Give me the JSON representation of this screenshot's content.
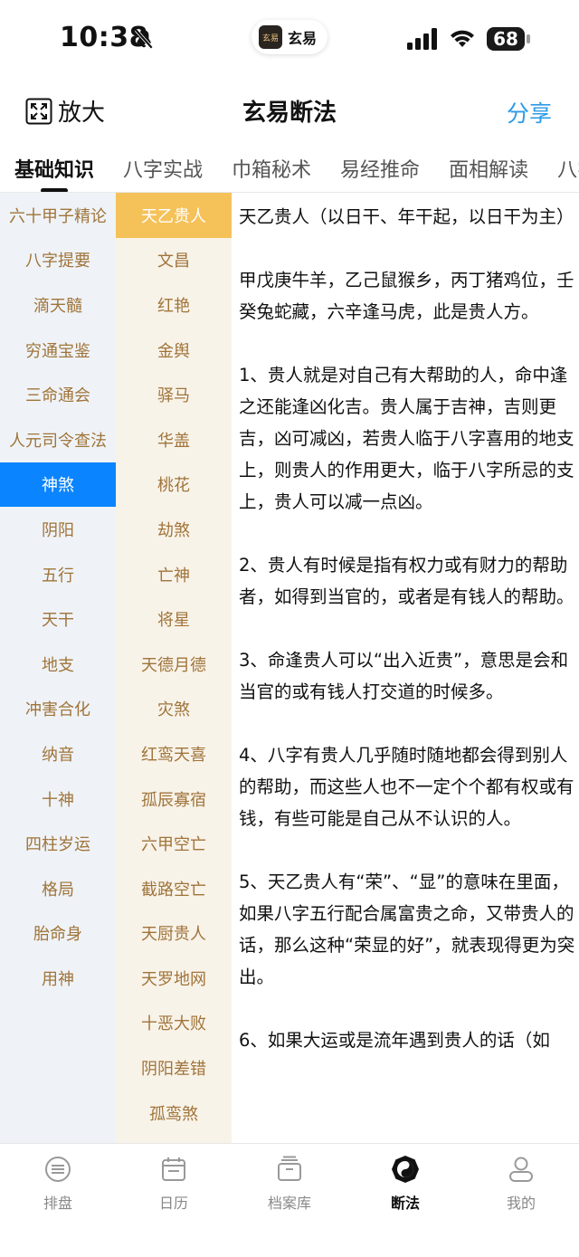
{
  "status": {
    "time": "10:38",
    "app_name": "玄易",
    "app_logo_text": "玄易",
    "battery": "68"
  },
  "header": {
    "zoom_label": "放大",
    "title": "玄易断法",
    "share_label": "分享"
  },
  "tabs": [
    {
      "label": "基础知识",
      "active": true
    },
    {
      "label": "八字实战",
      "active": false
    },
    {
      "label": "巾箱秘术",
      "active": false
    },
    {
      "label": "易经推命",
      "active": false
    },
    {
      "label": "面相解读",
      "active": false
    },
    {
      "label": "八字",
      "active": false
    }
  ],
  "categories": [
    "六十甲子精论",
    "八字提要",
    "滴天髓",
    "穷通宝鉴",
    "三命通会",
    "人元司令查法",
    "神煞",
    "阴阳",
    "五行",
    "天干",
    "地支",
    "冲害合化",
    "纳音",
    "十神",
    "四柱岁运",
    "格局",
    "胎命身",
    "用神"
  ],
  "active_category": "神煞",
  "subcategories": [
    "天乙贵人",
    "文昌",
    "红艳",
    "金舆",
    "驿马",
    "华盖",
    "桃花",
    "劫煞",
    "亡神",
    "将星",
    "天德月德",
    "灾煞",
    "红鸾天喜",
    "孤辰寡宿",
    "六甲空亡",
    "截路空亡",
    "天厨贵人",
    "天罗地网",
    "十恶大败",
    "阴阳差错",
    "孤鸾煞"
  ],
  "active_subcategory": "天乙贵人",
  "content": {
    "paragraphs": [
      "天乙贵人（以日干、年干起，以日干为主）",
      "甲戊庚牛羊，乙己鼠猴乡，丙丁猪鸡位，壬癸兔蛇藏，六辛逢马虎，此是贵人方。",
      "1、贵人就是对自己有大帮助的人，命中逢之还能逢凶化吉。贵人属于吉神，吉则更吉，凶可减凶，若贵人临于八字喜用的地支上，则贵人的作用更大，临于八字所忌的支上，贵人可以减一点凶。",
      "2、贵人有时候是指有权力或有财力的帮助者，如得到当官的，或者是有钱人的帮助。",
      "3、命逢贵人可以“出入近贵”，意思是会和当官的或有钱人打交道的时候多。",
      "4、八字有贵人几乎随时随地都会得到别人的帮助，而这些人也不一定个个都有权或有钱，有些可能是自己从不认识的人。",
      "5、天乙贵人有“荣”、“显”的意味在里面，如果八字五行配合属富贵之命，又带贵人的话，那么这种“荣显的好”，就表现得更为突出。",
      "6、如果大运或是流年遇到贵人的话（如"
    ]
  },
  "bottom_nav": [
    {
      "label": "排盘",
      "icon": "paipan-icon",
      "active": false
    },
    {
      "label": "日历",
      "icon": "calendar-icon",
      "active": false
    },
    {
      "label": "档案库",
      "icon": "archive-icon",
      "active": false
    },
    {
      "label": "断法",
      "icon": "duanfa-icon",
      "active": true
    },
    {
      "label": "我的",
      "icon": "profile-icon",
      "active": false
    }
  ],
  "colors": {
    "accent_blue": "#0a84ff",
    "accent_gold": "#f5c25a",
    "link_blue": "#2d9be6",
    "category_text": "#a0743a"
  }
}
